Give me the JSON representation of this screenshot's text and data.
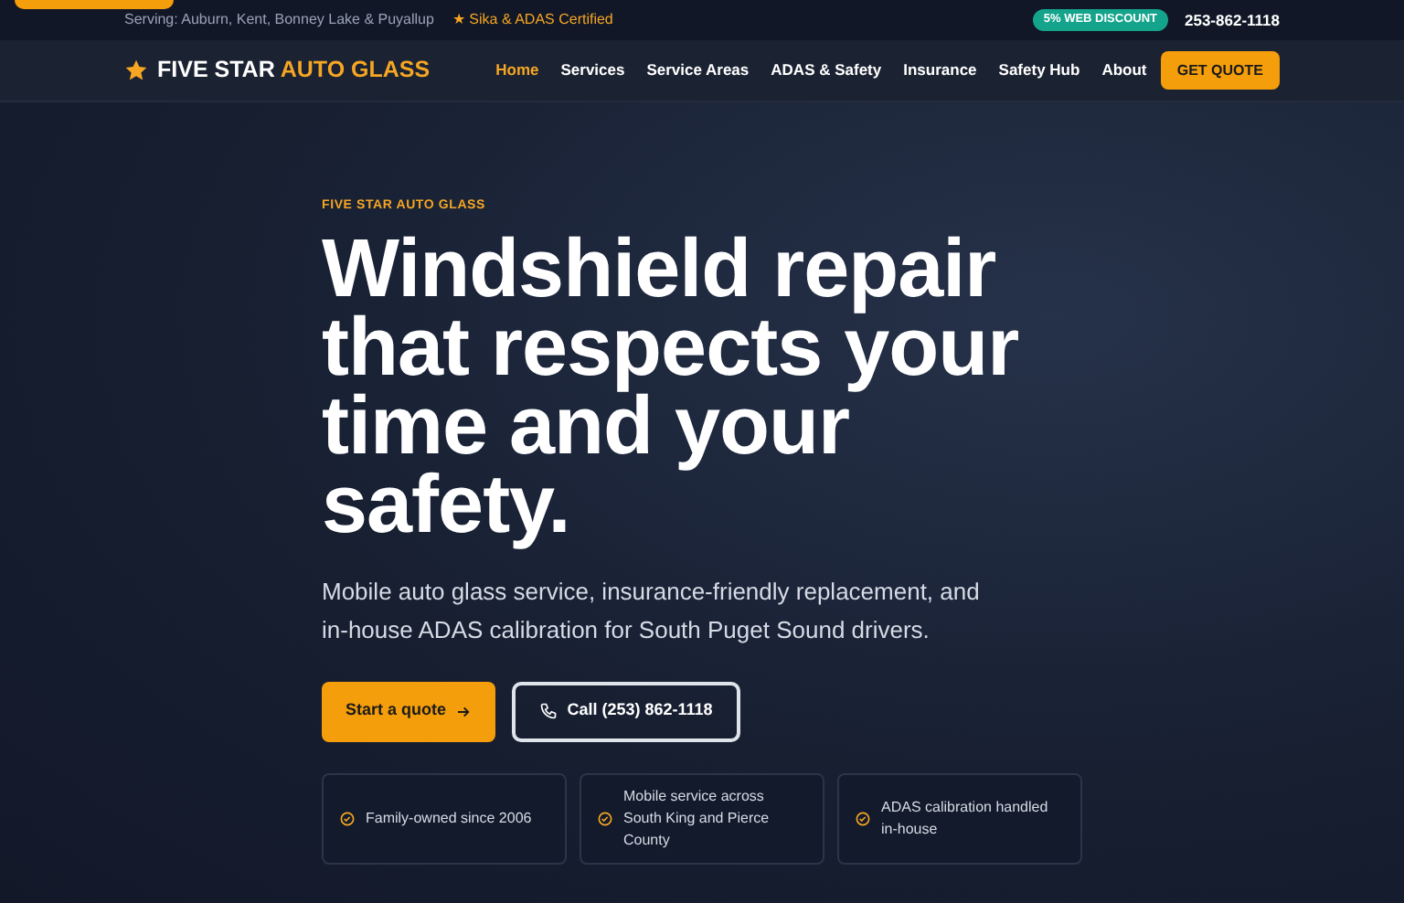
{
  "topbar": {
    "serving": "Serving: Auburn, Kent, Bonney Lake & Puyallup",
    "certified": "★ Sika & ADAS Certified",
    "discount": "5% WEB DISCOUNT",
    "phone": "253-862-1118"
  },
  "brand": {
    "first": "FIVE STAR",
    "second": "AUTO GLASS"
  },
  "nav": [
    {
      "label": "Home",
      "selected": true
    },
    {
      "label": "Services",
      "selected": false
    },
    {
      "label": "Service Areas",
      "selected": false
    },
    {
      "label": "ADAS & Safety",
      "selected": false
    },
    {
      "label": "Insurance",
      "selected": false
    },
    {
      "label": "Safety Hub",
      "selected": false
    },
    {
      "label": "About",
      "selected": false
    }
  ],
  "cta": "GET QUOTE",
  "hero": {
    "eyebrow": "FIVE STAR AUTO GLASS",
    "title": "Windshield repair that respects your time and your safety.",
    "lead": "Mobile auto glass service, insurance-friendly replacement, and in-house ADAS calibration for South Puget Sound drivers.",
    "primary": "Start a quote",
    "secondary": "Call (253) 862-1118"
  },
  "features": [
    "Family-owned since 2006",
    "Mobile service across South King and Pierce County",
    "ADAS calibration handled in-house"
  ]
}
